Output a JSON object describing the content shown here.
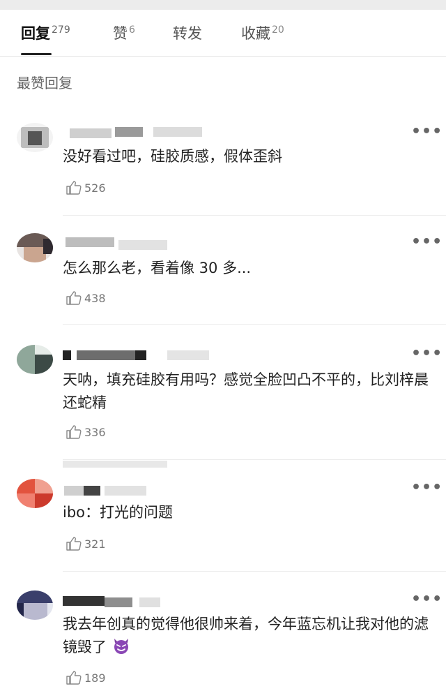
{
  "tabs": [
    {
      "label": "回复",
      "count": "279",
      "active": true
    },
    {
      "label": "赞",
      "count": "6",
      "active": false
    },
    {
      "label": "转发",
      "count": "",
      "active": false
    },
    {
      "label": "收藏",
      "count": "20",
      "active": false
    }
  ],
  "section_title": "最赞回复",
  "comments": [
    {
      "text": "没好看过吧，硅胶质感，假体歪斜",
      "likes": "526"
    },
    {
      "text": "怎么那么老，看着像 30 多...",
      "likes": "438"
    },
    {
      "text": "天呐，填充硅胶有用吗？感觉全脸凹凸不平的，比刘梓晨还蛇精",
      "likes": "336"
    },
    {
      "text": "ibo：打光的问题",
      "likes": "321"
    },
    {
      "text": "我去年创真的觉得他很帅来着，今年蓝忘机让我对他的滤镜毁了",
      "likes": "189",
      "emoji": "smiling-imp"
    }
  ],
  "icons": {
    "like": "thumbs-up-icon",
    "more": "more-dots-icon"
  },
  "colors": {
    "text": "#222222",
    "muted": "#777777",
    "emoji_purple": "#7b3fa0"
  }
}
